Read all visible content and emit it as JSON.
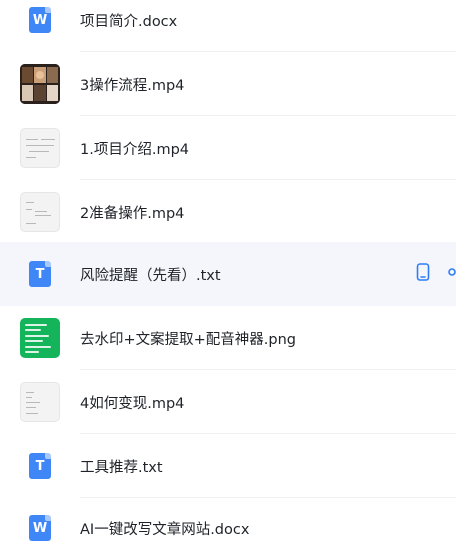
{
  "files": [
    {
      "name": "项目简介.docx",
      "type": "docx",
      "icon": "word-doc-icon",
      "glyph": "W",
      "color": "#3f86f6"
    },
    {
      "name": "3操作流程.mp4",
      "type": "mp4",
      "icon": "video-thumbnail",
      "color": "#2a211c"
    },
    {
      "name": "1.项目介绍.mp4",
      "type": "mp4",
      "icon": "video-thumbnail",
      "color": "#f3f3f3"
    },
    {
      "name": "2准备操作.mp4",
      "type": "mp4",
      "icon": "video-thumbnail",
      "color": "#f3f3f3"
    },
    {
      "name": "风险提醒（先看）.txt",
      "type": "txt",
      "icon": "text-file-icon",
      "glyph": "T",
      "color": "#3f86f6",
      "selected": true
    },
    {
      "name": "去水印+文案提取+配音神器.png",
      "type": "png",
      "icon": "image-thumbnail",
      "color": "#14b45b"
    },
    {
      "name": "4如何变现.mp4",
      "type": "mp4",
      "icon": "video-thumbnail",
      "color": "#f3f3f3"
    },
    {
      "name": "工具推荐.txt",
      "type": "txt",
      "icon": "text-file-icon",
      "glyph": "T",
      "color": "#3f86f6"
    },
    {
      "name": "AI一键改写文章网站.docx",
      "type": "docx",
      "icon": "word-doc-icon",
      "glyph": "W",
      "color": "#3f86f6"
    }
  ],
  "row_actions": {
    "icons": [
      "phone-icon",
      "share-icon"
    ],
    "color": "#2f7cf6"
  }
}
